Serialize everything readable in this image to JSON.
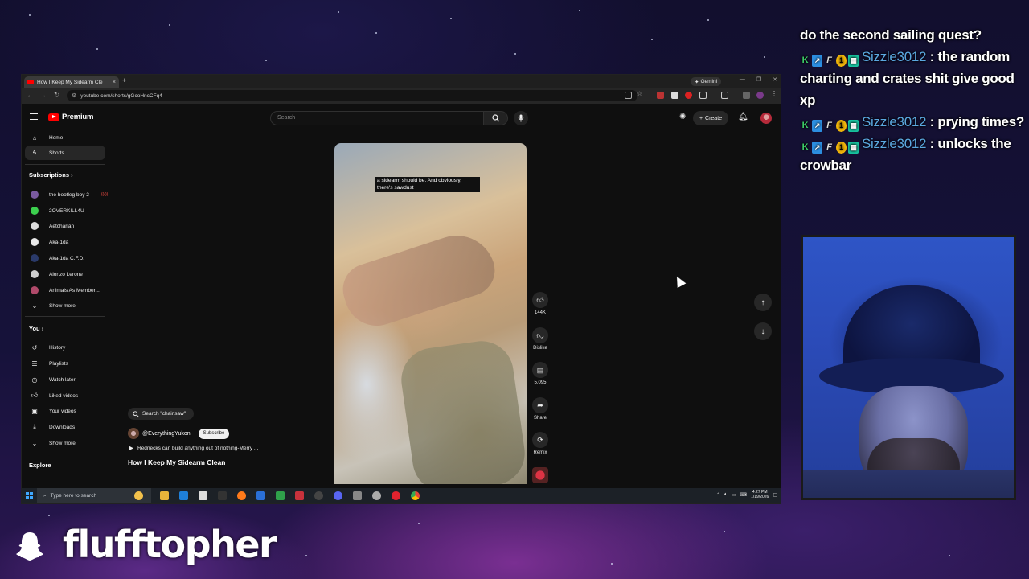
{
  "browser": {
    "tab_title": "How I Keep My Sidearm Cle",
    "new_tab": "+",
    "gemini_label": "Gemini",
    "url": "youtube.com/shorts/gGcoHncCFq4"
  },
  "youtube": {
    "logo_text": "Premium",
    "search_placeholder": "Search",
    "create_label": "Create",
    "sidebar": {
      "main": [
        {
          "icon": "home-icon",
          "label": "Home"
        },
        {
          "icon": "shorts-icon",
          "label": "Shorts"
        }
      ],
      "subscriptions_header": "Subscriptions",
      "channels": [
        {
          "label": "the bootleg boy 2",
          "color": "#7a5aa0",
          "live": true
        },
        {
          "label": "2OVERKILL4U",
          "color": "#3ccf4e",
          "live": false
        },
        {
          "label": "Aetcharian",
          "color": "#dddddd",
          "live": false
        },
        {
          "label": "Aka-1da",
          "color": "#e8e8e8",
          "live": false
        },
        {
          "label": "Aka-1da C.F.D.",
          "color": "#2a3a6a",
          "live": false
        },
        {
          "label": "Alonzo Lerone",
          "color": "#cfcfcf",
          "live": false
        },
        {
          "label": "Animals As Member...",
          "color": "#b04a6a",
          "live": false
        }
      ],
      "show_more": "Show more",
      "you_header": "You",
      "you_items": [
        {
          "icon": "history-icon",
          "label": "History"
        },
        {
          "icon": "playlists-icon",
          "label": "Playlists"
        },
        {
          "icon": "watch-later-icon",
          "label": "Watch later"
        },
        {
          "icon": "liked-videos-icon",
          "label": "Liked videos"
        },
        {
          "icon": "your-videos-icon",
          "label": "Your videos"
        },
        {
          "icon": "downloads-icon",
          "label": "Downloads"
        },
        {
          "icon": "chevron-down-icon",
          "label": "Show more"
        }
      ],
      "explore_header": "Explore"
    },
    "short": {
      "caption": "a sidearm should be. And obviously, there's sawdust",
      "likes": "144K",
      "dislike_label": "Dislike",
      "comments": "5,095",
      "share_label": "Share",
      "remix_label": "Remix",
      "search_chip": "Search \"chainsaw\"",
      "channel_handle": "@EverythingYukon",
      "subscribe_label": "Subscribe",
      "music": "Rednecks can build anything out of nothing-Merry ...",
      "title": "How I Keep My Sidearm Clean⁣"
    }
  },
  "taskbar": {
    "search_placeholder": "Type here to search",
    "time": "4:27 PM",
    "date": "1/19/2026"
  },
  "chat": {
    "lines": [
      {
        "user": "",
        "text": "do the second sailing quest?"
      },
      {
        "user": "Sizzle3012",
        "text": " : the random charting and crates shit give good xp"
      },
      {
        "user": "Sizzle3012",
        "text": " : prying times?"
      },
      {
        "user": "Sizzle3012",
        "text": " : unlocks the crowbar"
      }
    ]
  },
  "streamer_name": "flufftopher"
}
